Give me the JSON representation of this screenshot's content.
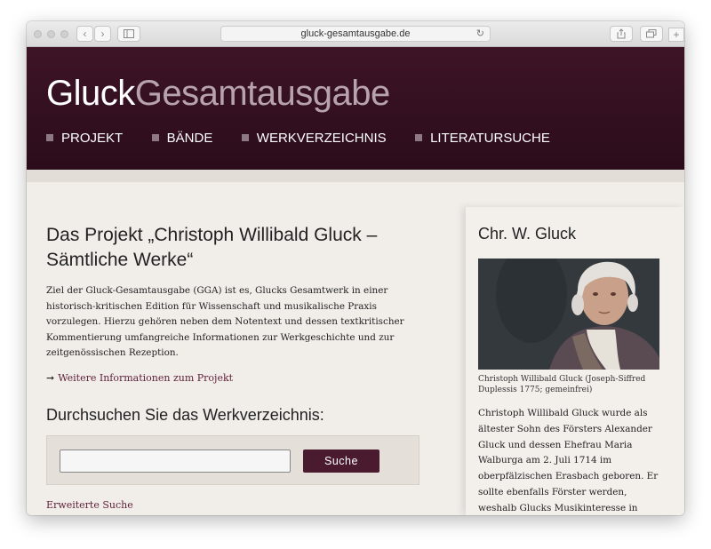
{
  "browser": {
    "url": "gluck-gesamtausgabe.de"
  },
  "site": {
    "logo_bold": "Gluck",
    "logo_light": "Gesamtausgabe",
    "nav": [
      "PROJEKT",
      "BÄNDE",
      "WERKVERZEICHNIS",
      "LITERATURSUCHE"
    ]
  },
  "main": {
    "title_line1": "Das Projekt „Christoph Willibald Gluck –",
    "title_line2": "Sämtliche Werke“",
    "intro": "Ziel der Gluck-Gesamtausgabe (GGA) ist es, Glucks Gesamtwerk in einer historisch-kritischen Edition für Wissenschaft und musikalische Praxis vorzulegen. Hierzu gehören neben dem Notentext und dessen textkritischer Kommentierung umfangreiche Informationen zur Werkgeschichte und zur zeitgenössischen Rezeption.",
    "more_link": "Weitere Informationen zum Projekt",
    "search_heading": "Durchsuchen Sie das Werkverzeichnis:",
    "search_value": "",
    "search_button": "Suche",
    "advanced_link": "Erweiterte Suche"
  },
  "sidebar": {
    "title": "Chr. W. Gluck",
    "caption": "Christoph Willibald Gluck (Joseph-Siffred Duplessis 1775; gemeinfrei)",
    "bio": "Christoph Willibald Gluck wurde als ältester Sohn des Försters Alexander Gluck und dessen Ehefrau Maria Walburga am 2. Juli 1714 im oberpfälzischen Erasbach geboren. Er sollte ebenfalls Förster werden, weshalb Glucks Musikinteresse in seiner Jugend..."
  },
  "colors": {
    "header": "#2e0e1c",
    "accent": "#4a1a2e",
    "link": "#5e1f39",
    "page_bg": "#f1eeea"
  }
}
